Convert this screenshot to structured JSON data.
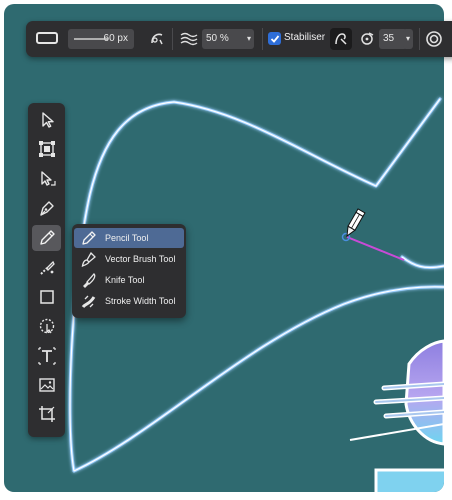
{
  "app": {
    "accent": "#2e6ed8",
    "canvas_color": "#2f6a70"
  },
  "context_toolbar": {
    "stroke_preview_icon": "stroke-rectangle-icon",
    "width_value": "60 px",
    "pressure_icon": "pressure-icon",
    "smoothing_icon": "waves-icon",
    "opacity_value": "50 %",
    "stabiliser_checked": true,
    "stabiliser_label": "Stabiliser",
    "rope_mode_icon": "rope-icon",
    "window_mode_icon": "window-icon",
    "stabiliser_value": "35"
  },
  "tools_panel": {
    "tools": [
      {
        "name": "move-tool",
        "icon": "arrow-icon"
      },
      {
        "name": "artboard-tool",
        "icon": "selection-box-icon"
      },
      {
        "name": "node-tool",
        "icon": "node-arrow-icon"
      },
      {
        "name": "pen-tool",
        "icon": "pen-nib-icon"
      },
      {
        "name": "pencil-tool",
        "icon": "pencil-icon",
        "active": true
      },
      {
        "name": "fill-tool",
        "icon": "brush-icon"
      },
      {
        "name": "rectangle-tool",
        "icon": "rectangle-icon"
      },
      {
        "name": "shape-tool",
        "icon": "dotted-shape-icon"
      },
      {
        "name": "text-tool",
        "icon": "artistic-text-icon"
      },
      {
        "name": "place-image-tool",
        "icon": "image-icon"
      },
      {
        "name": "crop-tool",
        "icon": "crop-icon"
      }
    ]
  },
  "flyout": {
    "items": [
      {
        "label": "Pencil Tool",
        "icon": "pencil-icon",
        "selected": true
      },
      {
        "label": "Vector Brush Tool",
        "icon": "vector-brush-icon"
      },
      {
        "label": "Knife Tool",
        "icon": "knife-icon"
      },
      {
        "label": "Stroke Width Tool",
        "icon": "stroke-width-icon"
      }
    ]
  }
}
